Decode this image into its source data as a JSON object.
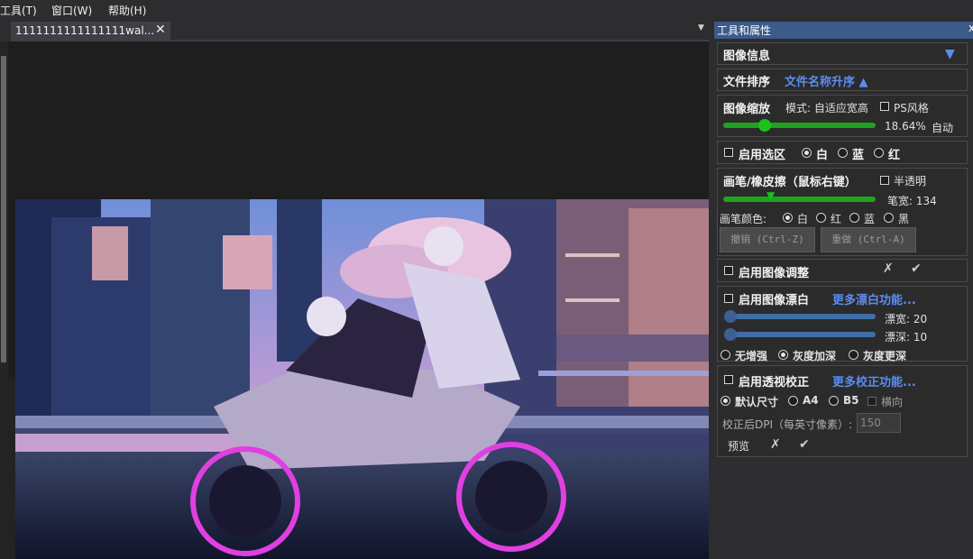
{
  "menu": {
    "tools": "工具(T)",
    "window": "窗口(W)",
    "help": "帮助(H)"
  },
  "tab": {
    "title": "1111111111111111wal...",
    "close": "✕"
  },
  "panel": {
    "title": "工具和属性",
    "close": "x",
    "image_info": {
      "label": "图像信息",
      "arrow": "▼"
    },
    "sort": {
      "label": "文件排序",
      "value": "文件名称升序 ▲"
    },
    "zoom": {
      "label": "图像缩放",
      "mode": "模式: 自适应宽高",
      "ps_style": "PS风格",
      "percent": "18.64%",
      "auto": "自动",
      "level": 0.18
    },
    "selection": {
      "label": "启用选区",
      "options": [
        "白",
        "蓝",
        "红"
      ],
      "selected": 0
    },
    "brush": {
      "label": "画笔/橡皮擦（鼠标右键）",
      "semi": "半透明",
      "width_label": "笔宽: 134",
      "color_label": "画笔颜色:",
      "colors": [
        "白",
        "红",
        "蓝",
        "黑"
      ],
      "undo": "撤销 (Ctrl-Z)",
      "redo": "重做 (Ctrl-A)"
    },
    "adjust": {
      "label": "启用图像调整",
      "cancel": "✗",
      "ok": "✔"
    },
    "whiten": {
      "label": "启用图像漂白",
      "more": "更多漂白功能...",
      "width": "漂宽: 20",
      "depth": "漂深: 10",
      "opts": [
        "无增强",
        "灰度加深",
        "灰度更深"
      ]
    },
    "perspective": {
      "label": "启用透视校正",
      "more": "更多校正功能...",
      "opts": [
        "默认尺寸",
        "A4",
        "B5"
      ],
      "landscape": "横向",
      "dpi_label": "校正后DPI（每英寸像素）:",
      "dpi_value": "150",
      "preview": "预览",
      "cancel": "✗",
      "ok": "✔"
    }
  },
  "colors": {
    "accent": "#5b8def",
    "header": "#3c5a8a",
    "slider_green": "#1fa31f"
  }
}
